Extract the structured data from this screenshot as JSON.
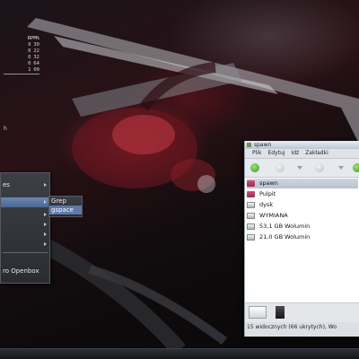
{
  "conky": {
    "header_label": "RPM%",
    "rows": [
      {
        "a": "9",
        "b": "30"
      },
      {
        "a": "0",
        "b": "22"
      },
      {
        "a": "0",
        "b": "32"
      },
      {
        "a": "0",
        "b": "64"
      },
      {
        "a": "1",
        "b": "00"
      }
    ],
    "graph_label": "h"
  },
  "openbox_menu": {
    "items": [
      {
        "label": "es",
        "has_submenu": true
      },
      {
        "label": "",
        "has_submenu": true,
        "selected": true
      },
      {
        "label": "",
        "has_submenu": true
      },
      {
        "label": "",
        "has_submenu": true
      },
      {
        "label": "",
        "has_submenu": true
      },
      {
        "label": "",
        "has_submenu": true
      },
      {
        "label": "",
        "has_submenu": false
      },
      {
        "label": "ro Openbox",
        "has_submenu": false
      },
      {
        "label": "",
        "has_submenu": false
      }
    ],
    "submenu": {
      "items": [
        {
          "label": "Grep",
          "selected": false
        },
        {
          "label": "gspace",
          "selected": true
        }
      ]
    }
  },
  "file_manager": {
    "title": "spawn",
    "menubar": [
      "Plik",
      "Edytuj",
      "Idź",
      "Zakładki"
    ],
    "places": [
      {
        "label": "spawn",
        "icon": "home-folder-icon",
        "selected": true
      },
      {
        "label": "Pulpit",
        "icon": "desktop-folder-icon",
        "selected": false
      },
      {
        "label": "dysk",
        "icon": "drive-icon",
        "selected": false
      },
      {
        "label": "WYMIANA",
        "icon": "drive-icon",
        "selected": false
      },
      {
        "label": "53,1 GB Wolumin",
        "icon": "drive-icon",
        "selected": false
      },
      {
        "label": "21,0 GB Wolumin",
        "icon": "drive-icon",
        "selected": false
      }
    ],
    "status": "15 widocznych (66 ukrytych), Wo"
  },
  "colors": {
    "menu_selection": "#5d79a6",
    "add_button": "#5bbf3c",
    "titlebar": "#c9d4e0"
  }
}
